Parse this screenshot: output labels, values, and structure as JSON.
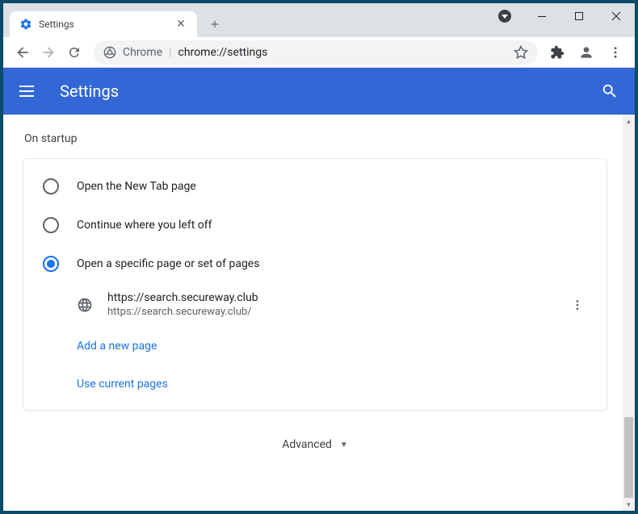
{
  "tab": {
    "title": "Settings"
  },
  "omnibox": {
    "prefix": "Chrome",
    "url": "chrome://settings"
  },
  "header": {
    "title": "Settings"
  },
  "section": {
    "title": "On startup"
  },
  "radios": [
    {
      "label": "Open the New Tab page"
    },
    {
      "label": "Continue where you left off"
    },
    {
      "label": "Open a specific page or set of pages"
    }
  ],
  "page": {
    "title": "https://search.secureway.club",
    "url": "https://search.secureway.club/"
  },
  "links": {
    "add": "Add a new page",
    "current": "Use current pages"
  },
  "advanced": "Advanced"
}
